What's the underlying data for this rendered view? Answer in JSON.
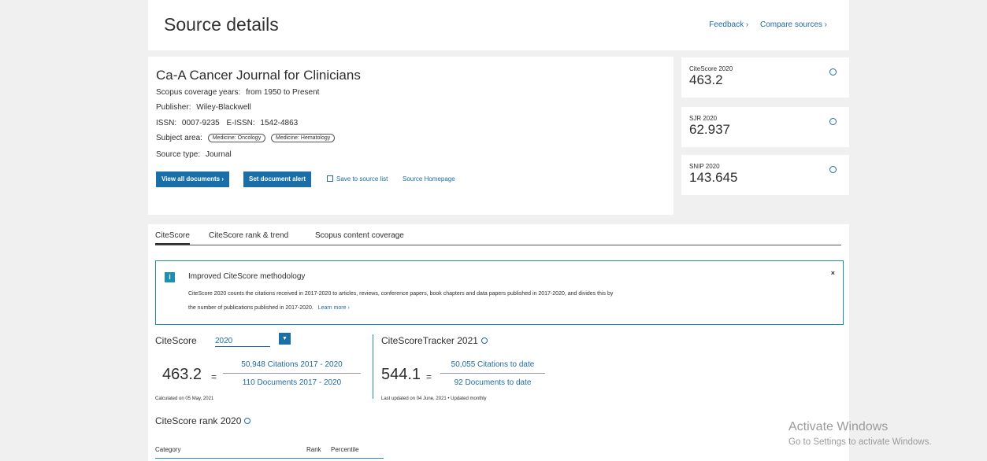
{
  "header": {
    "title": "Source details",
    "links": [
      "Feedback ›",
      "Compare sources ›"
    ]
  },
  "source": {
    "title": "Ca-A Cancer Journal for Clinicians",
    "coverage_label": "Scopus coverage years:",
    "coverage_value": "from 1950 to Present",
    "publisher_label": "Publisher:",
    "publisher_value": "Wiley-Blackwell",
    "issn_label": "ISSN:",
    "issn_value": "0007-9235",
    "eissn_label": "E-ISSN:",
    "eissn_value": "1542-4863",
    "subject_label": "Subject area:",
    "subjects": [
      "Medicine: Oncology",
      "Medicine: Hematology"
    ],
    "type_label": "Source type:",
    "type_value": "Journal"
  },
  "actions": {
    "view_all": "View all documents ›",
    "set_alert": "Set document alert",
    "save": "Save to source list",
    "homepage": "Source Homepage"
  },
  "metrics": [
    {
      "label": "CiteScore 2020",
      "value": "463.2"
    },
    {
      "label": "SJR 2020",
      "value": "62.937"
    },
    {
      "label": "SNIP 2020",
      "value": "143.645"
    }
  ],
  "tabs": [
    "CiteScore",
    "CiteScore rank & trend",
    "Scopus content coverage"
  ],
  "notice": {
    "icon": "i",
    "title": "Improved CiteScore methodology",
    "body": "CiteScore 2020 counts the citations received in 2017-2020 to articles, reviews, conference papers, book chapters and data papers published in 2017-2020, and divides this by the number of publications published in 2017-2020.",
    "learn_more": "Learn more ›",
    "close": "×"
  },
  "citescore": {
    "label": "CiteScore",
    "year": "2020",
    "value": "463.2",
    "eq": "=",
    "numerator": "50,948 Citations 2017 - 2020",
    "denominator": "110 Documents 2017 - 2020",
    "calculated": "Calculated on 05 May, 2021"
  },
  "tracker": {
    "title": "CiteScoreTracker 2021",
    "value": "544.1",
    "eq": "=",
    "numerator": "50,055 Citations to date",
    "denominator": "92 Documents to date",
    "updated": "Last updated on 04 June, 2021 • Updated monthly"
  },
  "rank": {
    "title": "CiteScore rank 2020",
    "col_category": "Category",
    "col_rank": "Rank",
    "col_percentile": "Percentile"
  },
  "watermark": {
    "title": "Activate Windows",
    "subtitle": "Go to Settings to activate Windows."
  }
}
